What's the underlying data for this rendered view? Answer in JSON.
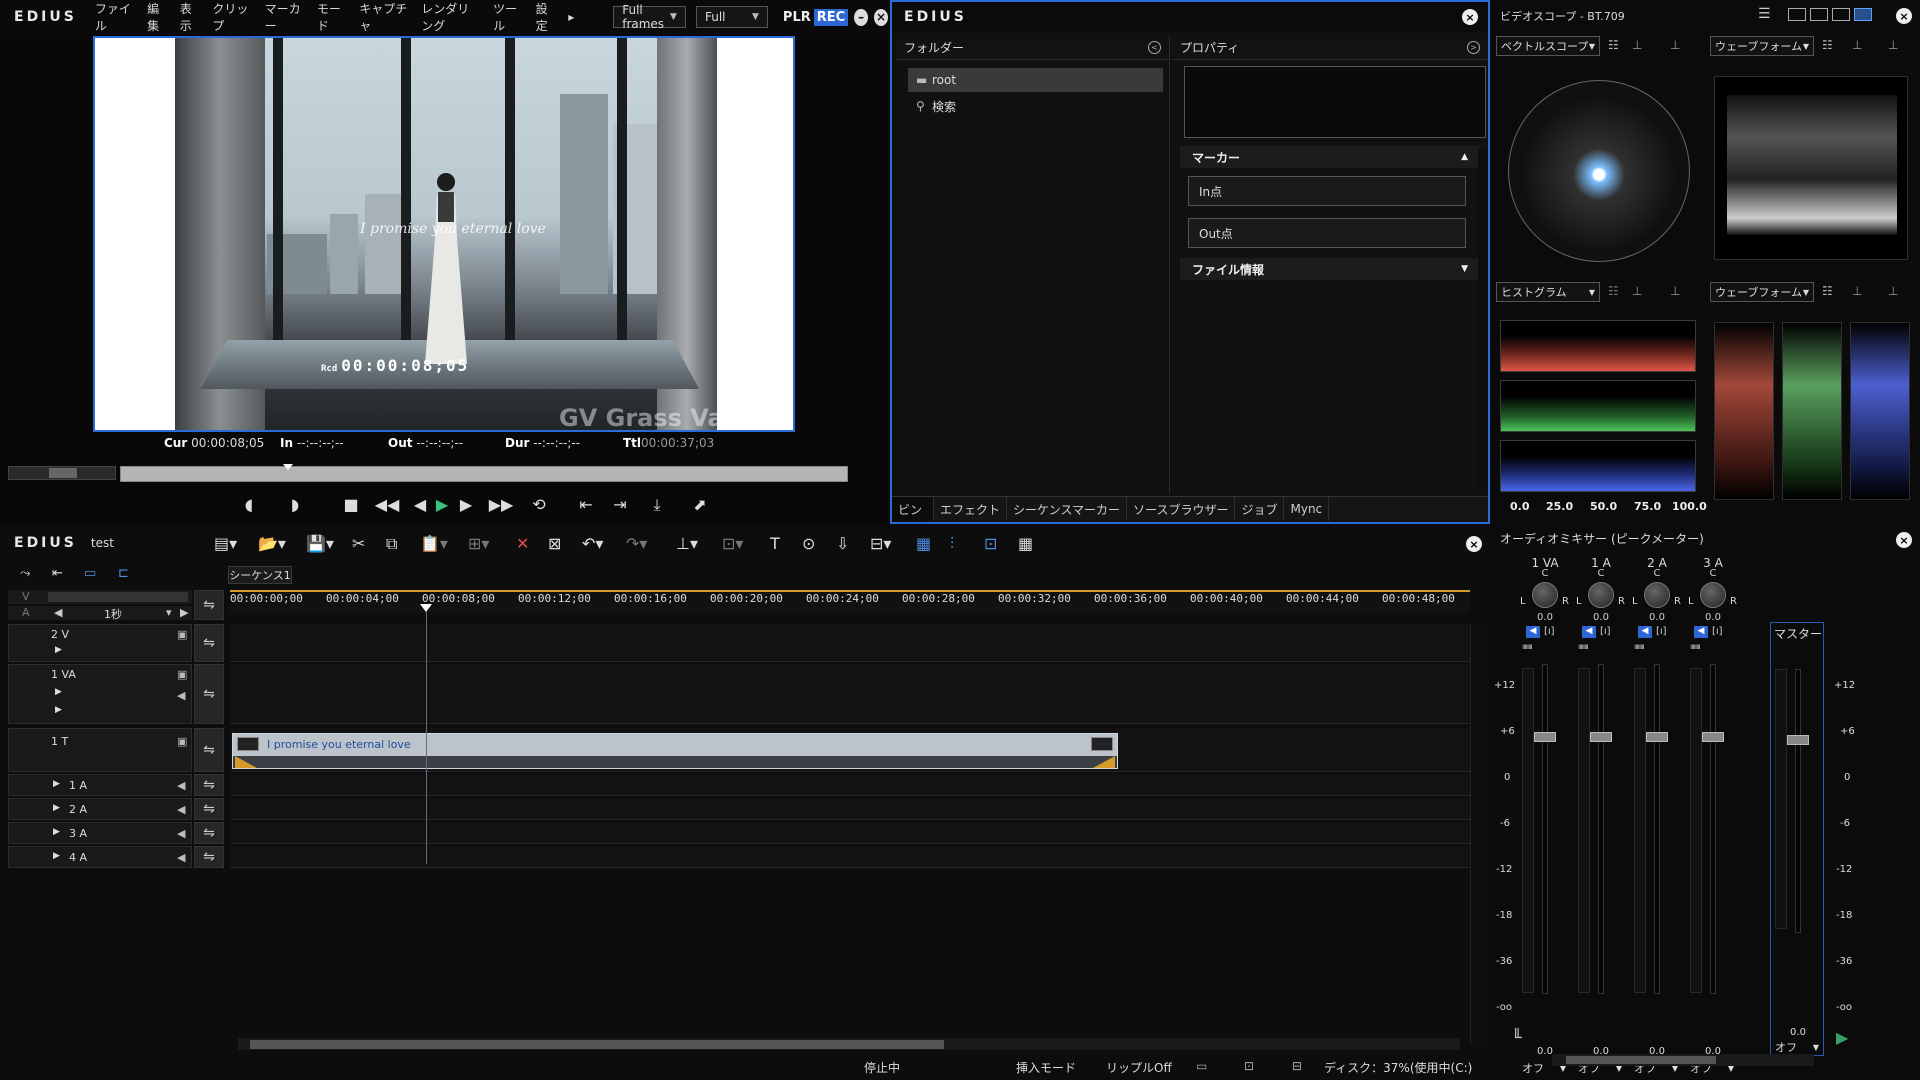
{
  "player": {
    "app_logo": "EDIUS",
    "menu": [
      "ファイル",
      "編集",
      "表示",
      "クリップ",
      "マーカー",
      "モード",
      "キャプチャ",
      "レンダリング",
      "ツール",
      "設定"
    ],
    "more_arrow": "▸",
    "dropdown_frames": "Full frames",
    "dropdown_quality": "Full",
    "plr": "PLR",
    "rec": "REC",
    "overlay_rcd": "Rcd",
    "overlay_timecode": "00:00:08;05",
    "overlay_text": "I promise you eternal love",
    "watermark": "GV  Grass Va",
    "cur_label": "Cur",
    "cur_value": "00:00:08;05",
    "in_label": "In",
    "in_value": "--:--:--;--",
    "out_label": "Out",
    "out_value": "--:--:--;--",
    "dur_label": "Dur",
    "dur_value": "--:--:--;--",
    "ttl_label": "Ttl",
    "ttl_value": "00:00:37;03"
  },
  "bin": {
    "app_logo": "EDIUS",
    "folder_header": "フォルダー",
    "folders": [
      "root",
      "検索"
    ],
    "properties_header": "プロパティ",
    "markers_section": "マーカー",
    "in_point": "In点",
    "out_point": "Out点",
    "file_info_section": "ファイル情報",
    "tabs": [
      "ビン",
      "エフェクト",
      "シーケンスマーカー",
      "ソースブラウザー",
      "ジョブ",
      "Mync"
    ]
  },
  "scopes": {
    "title": "ビデオスコープ - BT.709",
    "top_left_dd": "ベクトルスコープ",
    "top_right_dd": "ウェーブフォーム",
    "bottom_left_dd": "ヒストグラム",
    "bottom_right_dd": "ウェーブフォーム",
    "hist_scale": [
      "0.0",
      "25.0",
      "50.0",
      "75.0",
      "100.0"
    ],
    "colors": {
      "red": "#e0584a",
      "green": "#4ec45a",
      "blue": "#4a66e8"
    }
  },
  "timeline": {
    "app_logo": "EDIUS",
    "project_name": "test",
    "sequence_tab": "シーケンス1",
    "zoom_label": "1秒",
    "v_label": "V",
    "a_label": "A",
    "ruler": [
      "00:00:00;00",
      "00:00:04;00",
      "00:00:08;00",
      "00:00:12;00",
      "00:00:16;00",
      "00:00:20;00",
      "00:00:24;00",
      "00:00:28;00",
      "00:00:32;00",
      "00:00:36;00",
      "00:00:40;00",
      "00:00:44;00",
      "00:00:48;00"
    ],
    "tracks": [
      {
        "name": "2 V"
      },
      {
        "name": "1 VA"
      },
      {
        "name": "1 T"
      },
      {
        "name": "1 A"
      },
      {
        "name": "2 A"
      },
      {
        "name": "3 A"
      },
      {
        "name": "4 A"
      }
    ],
    "clip_label": "I promise you eternal love",
    "status": {
      "state": "停止中",
      "insert_mode": "挿入モード",
      "ripple": "リップルOff",
      "disk": "ディスク：37%(使用中(C:)"
    }
  },
  "mixer": {
    "title": "オーディオミキサー (ピークメーター)",
    "channels": [
      {
        "name": "1 VA",
        "pan": "C",
        "val": "0.0",
        "gain": "0.0",
        "mode": "オフ"
      },
      {
        "name": "1 A",
        "pan": "C",
        "val": "0.0",
        "gain": "0.0",
        "mode": "オフ"
      },
      {
        "name": "2 A",
        "pan": "C",
        "val": "0.0",
        "gain": "0.0",
        "mode": "オフ"
      },
      {
        "name": "3 A",
        "pan": "C",
        "val": "0.0",
        "gain": "0.0",
        "mode": "オフ"
      }
    ],
    "master": {
      "name": "マスター",
      "gain": "0.0",
      "mode": "オフ"
    },
    "db_scale": [
      "+12",
      "+6",
      "0",
      "-6",
      "-12",
      "-18",
      "-36",
      "-oo"
    ],
    "l": "L",
    "r": "R"
  }
}
